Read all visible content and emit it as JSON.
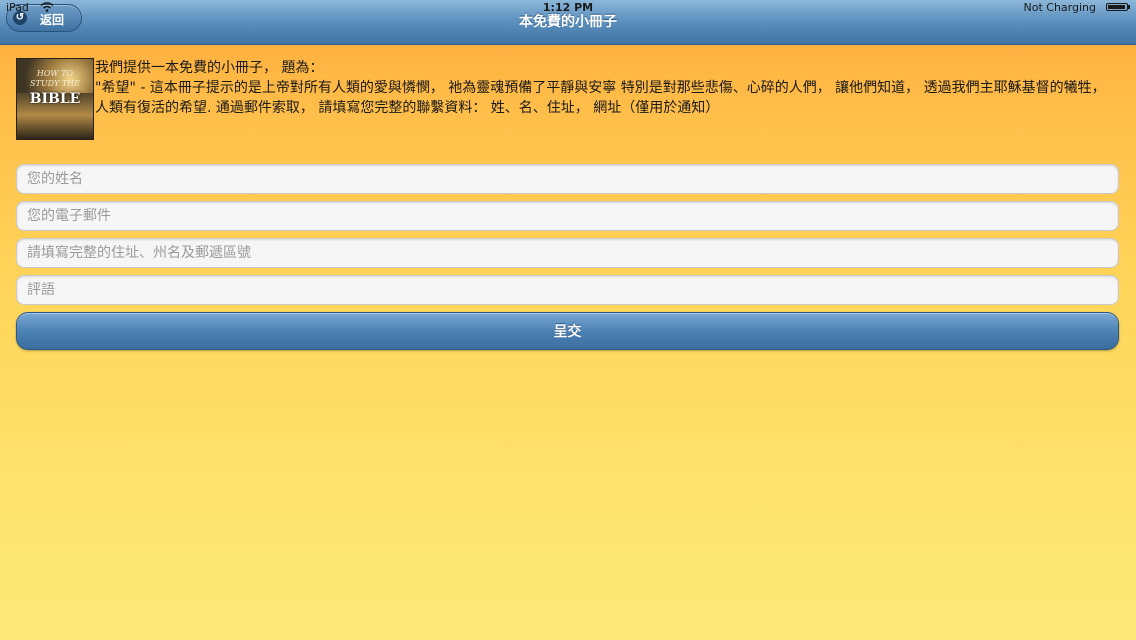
{
  "status_bar": {
    "device": "iPad",
    "time": "1:12 PM",
    "charging": "Not Charging"
  },
  "nav": {
    "title": "本免費的小冊子",
    "back_label": "返回"
  },
  "book": {
    "line1": "HOW TO",
    "line2": "STUDY THE",
    "title": "BIBLE"
  },
  "intro": {
    "line1": "我們提供一本免費的小冊子， 題為：",
    "line2": "\"希望\" - 這本冊子提示的是上帝對所有人類的愛與憐憫， 祂為靈魂預備了平靜與安寧 特別是對那些悲傷、心碎的人們， 讓他們知道， 透過我們主耶穌基督的犧牲， 人類有復活的希望. 通過郵件索取， 請填寫您完整的聯繫資料： 姓、名、住址， 網址（僅用於通知）"
  },
  "form": {
    "name_placeholder": "您的姓名",
    "email_placeholder": "您的電子郵件",
    "address_placeholder": "請填寫完整的住址、州名及郵遞區號",
    "comment_placeholder": "評語",
    "submit_label": "呈交"
  },
  "colors": {
    "nav_blue": "#4f83b3",
    "background_top": "#ffa93a",
    "background_bottom": "#fce978"
  }
}
